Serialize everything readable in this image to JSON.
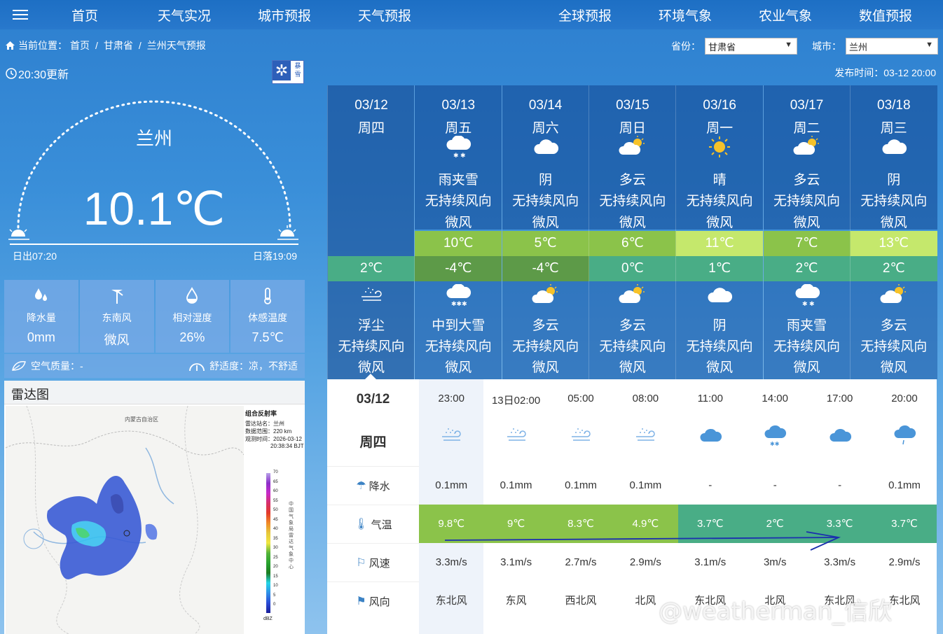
{
  "nav": {
    "items": [
      "首页",
      "天气实况",
      "城市预报",
      "天气预报",
      "全球预报",
      "环境气象",
      "农业气象",
      "数值预报"
    ]
  },
  "breadcrumb": {
    "prefix": "当前位置：",
    "items": [
      "首页",
      "甘肃省",
      "兰州天气预报"
    ]
  },
  "selectors": {
    "province_label": "省份：",
    "province_value": "甘肃省",
    "city_label": "城市：",
    "city_value": "兰州"
  },
  "current": {
    "update_time": "20:30更新",
    "publish_time": "发布时间：03-12 20:00",
    "city": "兰州",
    "temp": "10.1℃",
    "sunrise": "日出07:20",
    "sunset": "日落19:09",
    "badge_text": "暴雪"
  },
  "stats": [
    {
      "label": "降水量",
      "value": "0mm",
      "icon": "raindrop-icon"
    },
    {
      "label": "东南风",
      "value": "微风",
      "icon": "wind-icon"
    },
    {
      "label": "相对湿度",
      "value": "26%",
      "icon": "humidity-icon"
    },
    {
      "label": "体感温度",
      "value": "7.5℃",
      "icon": "thermometer-icon"
    }
  ],
  "air": {
    "quality": "空气质量：-",
    "comfort": "舒适度：凉，不舒适"
  },
  "radar": {
    "title": "雷达图",
    "legend_title": "组合反射率",
    "station": "雷达站名：兰州",
    "range": "数据范围：220 km",
    "time1": "观测时间：2026-03-12",
    "time2": "20:38:34 BJT",
    "scale": [
      "70",
      "65",
      "60",
      "55",
      "50",
      "45",
      "40",
      "35",
      "30",
      "25",
      "20",
      "15",
      "10",
      "5",
      "0"
    ],
    "unit": "dBZ",
    "side_text": "中国气象局雷达气象中心",
    "region": "内蒙古自治区"
  },
  "forecast": [
    {
      "date": "03/12",
      "week": "周四",
      "hi": "",
      "lo": "2℃",
      "desc": "",
      "wd": "",
      "wf": "",
      "desc2": "浮尘",
      "wd2": "无持续风向",
      "wf2": "微风",
      "icon": "",
      "icon2": "dust-icon"
    },
    {
      "date": "03/13",
      "week": "周五",
      "hi": "10℃",
      "lo": "-4℃",
      "desc": "雨夹雪",
      "wd": "无持续风向",
      "wf": "微风",
      "desc2": "中到大雪",
      "wd2": "无持续风向",
      "wf2": "微风",
      "icon": "sleet-icon",
      "icon2": "snow-icon"
    },
    {
      "date": "03/14",
      "week": "周六",
      "hi": "5℃",
      "lo": "-4℃",
      "desc": "阴",
      "wd": "无持续风向",
      "wf": "微风",
      "desc2": "多云",
      "wd2": "无持续风向",
      "wf2": "微风",
      "icon": "cloud-icon",
      "icon2": "partly-cloudy-icon"
    },
    {
      "date": "03/15",
      "week": "周日",
      "hi": "6℃",
      "lo": "0℃",
      "desc": "多云",
      "wd": "无持续风向",
      "wf": "微风",
      "desc2": "多云",
      "wd2": "无持续风向",
      "wf2": "微风",
      "icon": "partly-cloudy-icon",
      "icon2": "partly-cloudy-icon"
    },
    {
      "date": "03/16",
      "week": "周一",
      "hi": "11℃",
      "lo": "1℃",
      "desc": "晴",
      "wd": "无持续风向",
      "wf": "微风",
      "desc2": "阴",
      "wd2": "无持续风向",
      "wf2": "微风",
      "icon": "sun-icon",
      "icon2": "cloud-icon"
    },
    {
      "date": "03/17",
      "week": "周二",
      "hi": "7℃",
      "lo": "2℃",
      "desc": "多云",
      "wd": "无持续风向",
      "wf": "微风",
      "desc2": "雨夹雪",
      "wd2": "无持续风向",
      "wf2": "微风",
      "icon": "partly-cloudy-icon",
      "icon2": "sleet-icon"
    },
    {
      "date": "03/18",
      "week": "周三",
      "hi": "13℃",
      "lo": "2℃",
      "desc": "阴",
      "wd": "无持续风向",
      "wf": "微风",
      "desc2": "多云",
      "wd2": "无持续风向",
      "wf2": "微风",
      "icon": "cloud-icon",
      "icon2": "partly-cloudy-icon"
    }
  ],
  "colors": {
    "hi": [
      "",
      "#8bc34a",
      "#8bc34a",
      "#8bc34a",
      "#c5e86c",
      "#8bc34a",
      "#c5e86c"
    ],
    "lo": [
      "#49ad86",
      "#5d9a48",
      "#5d9a48",
      "#49ad86",
      "#49ad86",
      "#49ad86",
      "#49ad86"
    ],
    "hourly_temp": [
      "#8bc34a",
      "#8bc34a",
      "#8bc34a",
      "#8bc34a",
      "#49ad86",
      "#49ad86",
      "#49ad86",
      "#49ad86"
    ]
  },
  "hourly": {
    "date": "03/12",
    "week": "周四",
    "labels": {
      "precip": "降水",
      "temp": "气温",
      "wind_speed": "风速",
      "wind_dir": "风向"
    },
    "times": [
      "23:00",
      "13日02:00",
      "05:00",
      "08:00",
      "11:00",
      "14:00",
      "17:00",
      "20:00"
    ],
    "icons": [
      "dust-icon",
      "dust-icon",
      "dust-icon",
      "dust-icon",
      "cloud-icon",
      "sleet-icon",
      "cloud-icon",
      "drizzle-icon"
    ],
    "precip": [
      "0.1mm",
      "0.1mm",
      "0.1mm",
      "0.1mm",
      "-",
      "-",
      "-",
      "0.1mm"
    ],
    "temp": [
      "9.8℃",
      "9℃",
      "8.3℃",
      "4.9℃",
      "3.7℃",
      "2℃",
      "3.3℃",
      "3.7℃"
    ],
    "wind_speed": [
      "3.3m/s",
      "3.1m/s",
      "2.7m/s",
      "2.9m/s",
      "3.1m/s",
      "3m/s",
      "3.3m/s",
      "2.9m/s"
    ],
    "wind_dir": [
      "东北风",
      "东风",
      "西北风",
      "北风",
      "东北风",
      "北风",
      "东北风",
      "东北风"
    ]
  },
  "watermark": "@weatherman_信欣"
}
